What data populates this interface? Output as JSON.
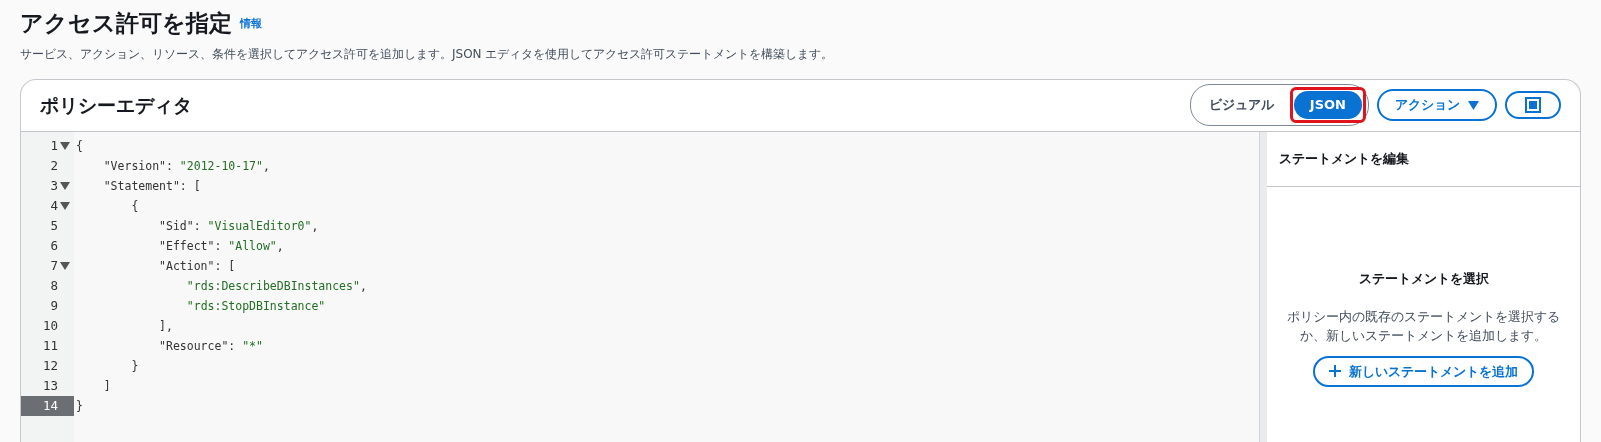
{
  "page": {
    "title": "アクセス許可を指定",
    "info_link": "情報",
    "description": "サービス、アクション、リソース、条件を選択してアクセス許可を追加します。JSON エディタを使用してアクセス許可ステートメントを構築します。"
  },
  "editor": {
    "title": "ポリシーエディタ",
    "modes": [
      {
        "label": "ビジュアル",
        "selected": false,
        "highlighted": false
      },
      {
        "label": "JSON",
        "selected": true,
        "highlighted": true
      }
    ],
    "actions_button": "アクション",
    "lines": [
      {
        "number": "1",
        "text": "{",
        "foldable": true,
        "selected": false
      },
      {
        "number": "2",
        "text": "    \"Version\": \"2012-10-17\",",
        "foldable": false,
        "selected": false
      },
      {
        "number": "3",
        "text": "    \"Statement\": [",
        "foldable": true,
        "selected": false
      },
      {
        "number": "4",
        "text": "        {",
        "foldable": true,
        "selected": false
      },
      {
        "number": "5",
        "text": "            \"Sid\": \"VisualEditor0\",",
        "foldable": false,
        "selected": false
      },
      {
        "number": "6",
        "text": "            \"Effect\": \"Allow\",",
        "foldable": false,
        "selected": false
      },
      {
        "number": "7",
        "text": "            \"Action\": [",
        "foldable": true,
        "selected": false
      },
      {
        "number": "8",
        "text": "                \"rds:DescribeDBInstances\",",
        "foldable": false,
        "selected": false
      },
      {
        "number": "9",
        "text": "                \"rds:StopDBInstance\"",
        "foldable": false,
        "selected": false
      },
      {
        "number": "10",
        "text": "            ],",
        "foldable": false,
        "selected": false
      },
      {
        "number": "11",
        "text": "            \"Resource\": \"*\"",
        "foldable": false,
        "selected": false
      },
      {
        "number": "12",
        "text": "        }",
        "foldable": false,
        "selected": false
      },
      {
        "number": "13",
        "text": "    ]",
        "foldable": false,
        "selected": false
      },
      {
        "number": "14",
        "text": "}",
        "foldable": false,
        "selected": true
      }
    ],
    "side_panel": {
      "title": "ステートメントを編集",
      "empty_title": "ステートメントを選択",
      "empty_text": "ポリシー内の既存のステートメントを選択するか、新しいステートメントを追加します。",
      "add_button": "新しいステートメントを追加"
    }
  }
}
